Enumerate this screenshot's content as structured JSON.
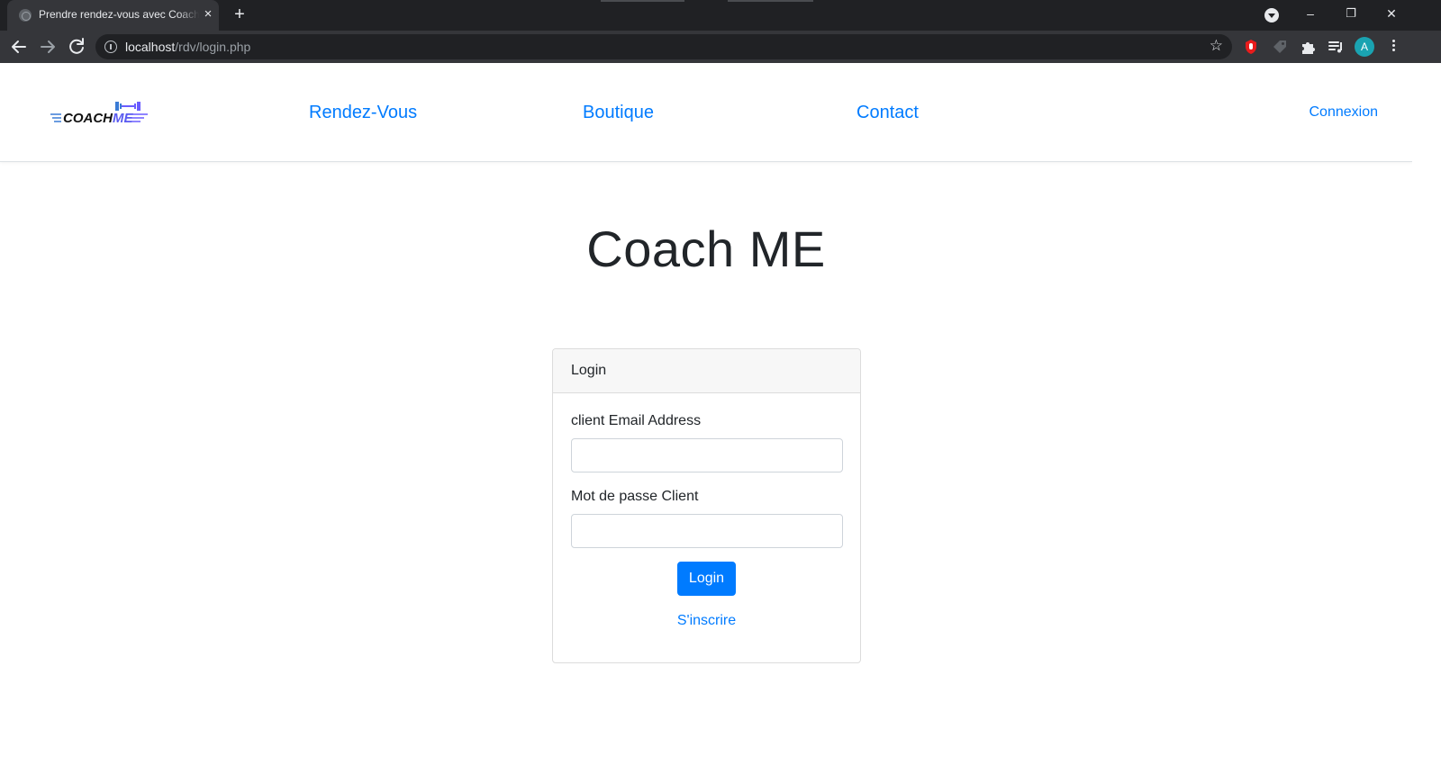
{
  "browser": {
    "tab_title": "Prendre rendez-vous avec CoachMe",
    "tab_close": "×",
    "new_tab": "+",
    "url_host": "localhost",
    "url_path": "/rdv/login.php",
    "profile_initial": "A",
    "window_controls": {
      "minimize": "–",
      "restore": "❐",
      "close": "✕"
    },
    "bookmark_star": "☆",
    "colors": {
      "chrome_dark": "#202124",
      "chrome_toolbar": "#35363a",
      "avatar": "#1aa3b1"
    }
  },
  "site": {
    "logo_text": "COACHME",
    "nav": {
      "rendezvous": "Rendez-Vous",
      "boutique": "Boutique",
      "contact": "Contact",
      "login": "Connexion"
    },
    "hero_title": "Coach ME",
    "colors": {
      "link": "#007bff",
      "text": "#212529"
    }
  },
  "login_card": {
    "header": "Login",
    "email_label": "client Email Address",
    "email_value": "",
    "password_label": "Mot de passe Client",
    "password_value": "",
    "submit_label": "Login",
    "signup_link": "S'inscrire"
  }
}
